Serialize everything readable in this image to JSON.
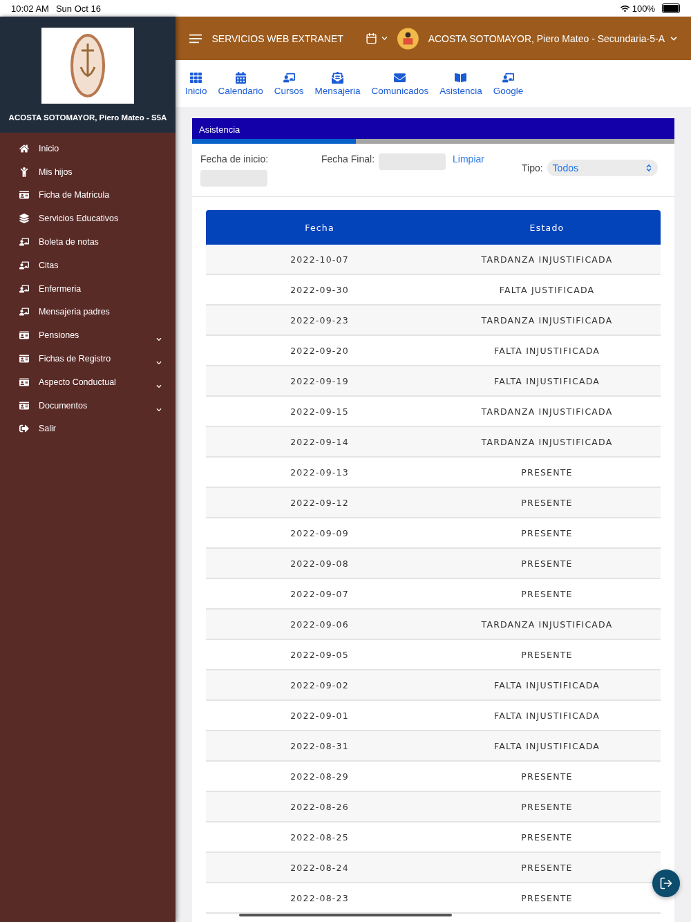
{
  "status_bar": {
    "time": "10:02 AM",
    "date": "Sun Oct 16",
    "battery": "100%"
  },
  "sidebar": {
    "student": "ACOSTA SOTOMAYOR, Piero Mateo - S5A",
    "items": [
      {
        "label": "Inicio",
        "expandable": false
      },
      {
        "label": "Mis hijos",
        "expandable": false
      },
      {
        "label": "Ficha de Matricula",
        "expandable": false
      },
      {
        "label": "Servicios Educativos",
        "expandable": false
      },
      {
        "label": "Boleta de notas",
        "expandable": false
      },
      {
        "label": "Citas",
        "expandable": false
      },
      {
        "label": "Enfermeria",
        "expandable": false
      },
      {
        "label": "Mensajeria padres",
        "expandable": false
      },
      {
        "label": "Pensiones",
        "expandable": true
      },
      {
        "label": "Fichas de Registro",
        "expandable": true
      },
      {
        "label": "Aspecto Conductual",
        "expandable": true
      },
      {
        "label": "Documentos",
        "expandable": true
      },
      {
        "label": "Salir",
        "expandable": false
      }
    ]
  },
  "header": {
    "title": "SERVICIOS WEB EXTRANET",
    "user": "ACOSTA SOTOMAYOR, Piero Mateo - Secundaria-5-A"
  },
  "nav": [
    {
      "label": "Inicio"
    },
    {
      "label": "Calendario"
    },
    {
      "label": "Cursos"
    },
    {
      "label": "Mensajeria"
    },
    {
      "label": "Comunicados"
    },
    {
      "label": "Asistencia"
    },
    {
      "label": "Google"
    }
  ],
  "panel": {
    "title": "Asistencia",
    "progress": {
      "level": 0.34
    },
    "filters": {
      "start_label": "Fecha de inicio:",
      "end_label": "Fecha Final:",
      "clear": "Limpiar",
      "type_label": "Tipo:",
      "type_value": "Todos"
    }
  },
  "table": {
    "columns": [
      "Fecha",
      "Estado"
    ],
    "rows": [
      [
        "2022-10-07",
        "TARDANZA INJUSTIFICADA"
      ],
      [
        "2022-09-30",
        "FALTA JUSTIFICADA"
      ],
      [
        "2022-09-23",
        "TARDANZA INJUSTIFICADA"
      ],
      [
        "2022-09-20",
        "FALTA INJUSTIFICADA"
      ],
      [
        "2022-09-19",
        "FALTA INJUSTIFICADA"
      ],
      [
        "2022-09-15",
        "TARDANZA INJUSTIFICADA"
      ],
      [
        "2022-09-14",
        "TARDANZA INJUSTIFICADA"
      ],
      [
        "2022-09-13",
        "PRESENTE"
      ],
      [
        "2022-09-12",
        "PRESENTE"
      ],
      [
        "2022-09-09",
        "PRESENTE"
      ],
      [
        "2022-09-08",
        "PRESENTE"
      ],
      [
        "2022-09-07",
        "PRESENTE"
      ],
      [
        "2022-09-06",
        "TARDANZA INJUSTIFICADA"
      ],
      [
        "2022-09-05",
        "PRESENTE"
      ],
      [
        "2022-09-02",
        "FALTA INJUSTIFICADA"
      ],
      [
        "2022-09-01",
        "FALTA INJUSTIFICADA"
      ],
      [
        "2022-08-31",
        "FALTA INJUSTIFICADA"
      ],
      [
        "2022-08-29",
        "PRESENTE"
      ],
      [
        "2022-08-26",
        "PRESENTE"
      ],
      [
        "2022-08-25",
        "PRESENTE"
      ],
      [
        "2022-08-24",
        "PRESENTE"
      ],
      [
        "2022-08-23",
        "PRESENTE"
      ]
    ]
  }
}
